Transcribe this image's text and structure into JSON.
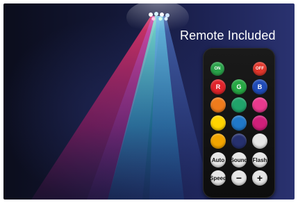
{
  "title": "Remote Included",
  "remote": {
    "power_on": "ON",
    "power_off": "OFF",
    "r": "R",
    "g": "G",
    "b": "B",
    "auto": "Auto",
    "sound": "Sound",
    "flash": "Flash",
    "speed": "Speed",
    "minus": "−",
    "plus": "+"
  },
  "colors": {
    "red": "#e0242b",
    "green": "#27a844",
    "blue": "#1f4bb8",
    "orange": "#f07b1c",
    "aqua_green": "#20a36a",
    "pink": "#e8398d",
    "yellow": "#ffd400",
    "sky_blue": "#2078c8",
    "magenta": "#d01f7a",
    "amber": "#f2a500",
    "dark_blue": "#26306e",
    "white": "#e6e6e6"
  }
}
